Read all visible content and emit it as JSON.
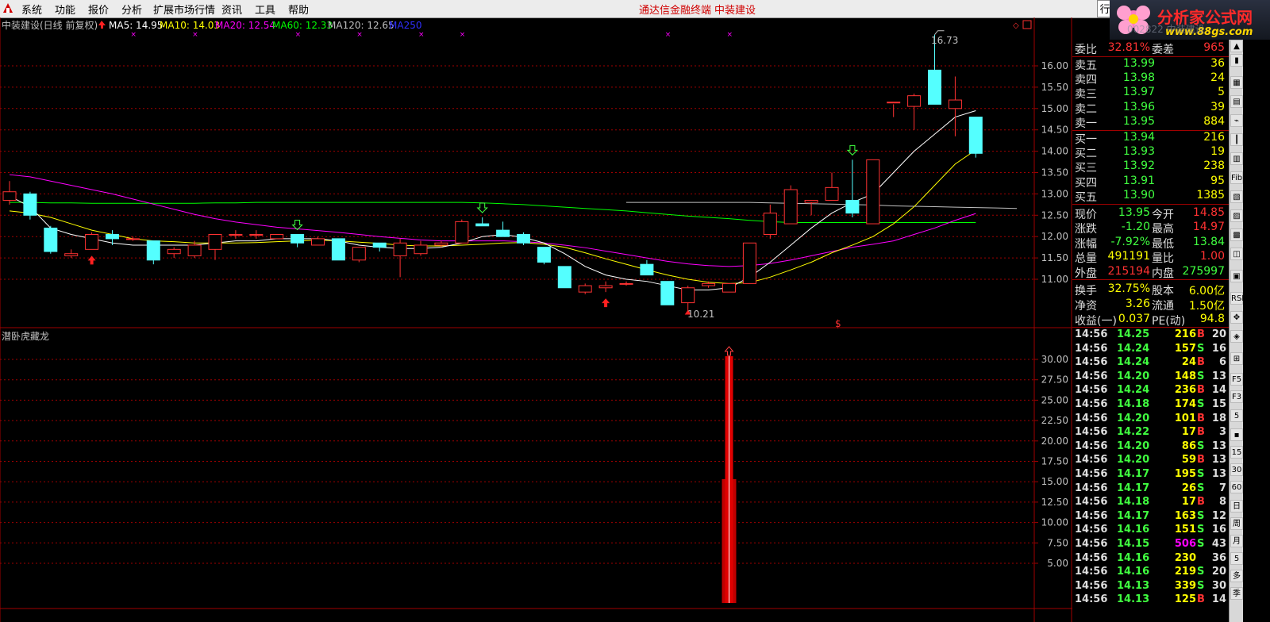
{
  "menubar": {
    "items": [
      "系统",
      "功能",
      "报价",
      "分析",
      "扩展市场行情",
      "资讯",
      "工具",
      "帮助"
    ],
    "center_title": "通达信金融终端",
    "center_stock": "中装建设",
    "side_tab": "行"
  },
  "brand": {
    "name": "分析家公式网",
    "url": "www.88gs.com",
    "behind_text": "002822 中装建设"
  },
  "chart_header": {
    "title": "中装建设(日线 前复权)",
    "ma5": "MA5: 14.95",
    "ma10": "MA10: 14.03",
    "ma20": "MA20: 12.54",
    "ma60": "MA60: 12.33",
    "ma120": "MA120: 12.65",
    "ma250": "MA250"
  },
  "indicator_title": "潜卧虎藏龙",
  "price_axis": [
    "16.00",
    "15.50",
    "15.00",
    "14.50",
    "14.00",
    "13.50",
    "13.00",
    "12.50",
    "12.00",
    "11.50",
    "11.00"
  ],
  "indicator_axis": [
    "30.00",
    "27.50",
    "25.00",
    "22.50",
    "20.00",
    "17.50",
    "15.00",
    "12.50",
    "10.00",
    "7.50",
    "5.00"
  ],
  "annotations": {
    "high": "16.73",
    "low": "10.21",
    "signal": "$"
  },
  "colors": {
    "up": "#ff3232",
    "down": "#54ffff",
    "ma5": "#ffffff",
    "ma10": "#ffff00",
    "ma20": "#ff00ff",
    "ma60": "#00ff00",
    "ma120": "#c0c0c0",
    "ma250": "#3030ff",
    "grid": "#a00000",
    "indicator_bar": "#c00000"
  },
  "chart_data": {
    "type": "candlestick",
    "price_ylim": [
      10.0,
      17.0
    ],
    "candles": [
      {
        "o": 12.85,
        "h": 13.3,
        "l": 12.75,
        "c": 13.05
      },
      {
        "o": 13.0,
        "h": 13.05,
        "l": 12.4,
        "c": 12.5
      },
      {
        "o": 12.2,
        "h": 12.25,
        "l": 11.6,
        "c": 11.65
      },
      {
        "o": 11.55,
        "h": 11.7,
        "l": 11.5,
        "c": 11.6
      },
      {
        "o": 11.7,
        "h": 12.1,
        "l": 11.7,
        "c": 12.05
      },
      {
        "o": 12.05,
        "h": 12.15,
        "l": 11.8,
        "c": 11.95
      },
      {
        "o": 11.95,
        "h": 12.0,
        "l": 11.9,
        "c": 11.95
      },
      {
        "o": 11.9,
        "h": 11.9,
        "l": 11.35,
        "c": 11.45
      },
      {
        "o": 11.6,
        "h": 11.75,
        "l": 11.5,
        "c": 11.7
      },
      {
        "o": 11.55,
        "h": 11.9,
        "l": 11.5,
        "c": 11.8
      },
      {
        "o": 11.7,
        "h": 12.05,
        "l": 11.45,
        "c": 12.05
      },
      {
        "o": 12.05,
        "h": 12.15,
        "l": 11.95,
        "c": 12.05
      },
      {
        "o": 12.05,
        "h": 12.15,
        "l": 11.95,
        "c": 12.05
      },
      {
        "o": 11.95,
        "h": 12.05,
        "l": 11.95,
        "c": 12.05
      },
      {
        "o": 12.05,
        "h": 12.05,
        "l": 11.75,
        "c": 11.85
      },
      {
        "o": 11.8,
        "h": 12.0,
        "l": 11.8,
        "c": 11.95
      },
      {
        "o": 11.95,
        "h": 11.95,
        "l": 11.45,
        "c": 11.45
      },
      {
        "o": 11.45,
        "h": 11.75,
        "l": 11.4,
        "c": 11.75
      },
      {
        "o": 11.85,
        "h": 11.85,
        "l": 11.65,
        "c": 11.75
      },
      {
        "o": 11.55,
        "h": 11.95,
        "l": 11.05,
        "c": 11.85
      },
      {
        "o": 11.6,
        "h": 11.9,
        "l": 11.55,
        "c": 11.8
      },
      {
        "o": 11.8,
        "h": 11.9,
        "l": 11.75,
        "c": 11.85
      },
      {
        "o": 11.85,
        "h": 12.4,
        "l": 11.85,
        "c": 12.35
      },
      {
        "o": 12.3,
        "h": 12.45,
        "l": 12.25,
        "c": 12.25
      },
      {
        "o": 12.15,
        "h": 12.35,
        "l": 12.0,
        "c": 12.0
      },
      {
        "o": 12.05,
        "h": 12.1,
        "l": 11.8,
        "c": 11.85
      },
      {
        "o": 11.75,
        "h": 11.75,
        "l": 11.35,
        "c": 11.4
      },
      {
        "o": 11.3,
        "h": 11.3,
        "l": 10.8,
        "c": 10.8
      },
      {
        "o": 10.7,
        "h": 10.9,
        "l": 10.65,
        "c": 10.85
      },
      {
        "o": 10.8,
        "h": 10.95,
        "l": 10.7,
        "c": 10.85
      },
      {
        "o": 10.9,
        "h": 10.95,
        "l": 10.85,
        "c": 10.9
      },
      {
        "o": 11.35,
        "h": 11.45,
        "l": 11.1,
        "c": 11.1
      },
      {
        "o": 10.95,
        "h": 10.95,
        "l": 10.4,
        "c": 10.4
      },
      {
        "o": 10.45,
        "h": 10.85,
        "l": 10.21,
        "c": 10.8
      },
      {
        "o": 10.85,
        "h": 10.95,
        "l": 10.8,
        "c": 10.9
      },
      {
        "o": 10.7,
        "h": 10.9,
        "l": 10.7,
        "c": 10.9
      },
      {
        "o": 10.9,
        "h": 11.85,
        "l": 10.9,
        "c": 11.85
      },
      {
        "o": 12.05,
        "h": 12.75,
        "l": 11.95,
        "c": 12.55
      },
      {
        "o": 12.3,
        "h": 13.2,
        "l": 12.3,
        "c": 13.1
      },
      {
        "o": 12.8,
        "h": 12.85,
        "l": 12.5,
        "c": 12.85
      },
      {
        "o": 12.85,
        "h": 13.5,
        "l": 12.85,
        "c": 13.15
      },
      {
        "o": 12.85,
        "h": 13.8,
        "l": 12.45,
        "c": 12.55
      },
      {
        "o": 12.3,
        "h": 13.8,
        "l": 12.3,
        "c": 13.8
      },
      {
        "o": 15.15,
        "h": 15.1,
        "l": 14.8,
        "c": 15.15
      },
      {
        "o": 15.05,
        "h": 15.35,
        "l": 14.5,
        "c": 15.3
      },
      {
        "o": 15.9,
        "h": 16.73,
        "l": 15.1,
        "c": 15.1
      },
      {
        "o": 15.0,
        "h": 15.75,
        "l": 14.35,
        "c": 15.2
      },
      {
        "o": 14.8,
        "h": 14.8,
        "l": 13.85,
        "c": 13.95
      }
    ],
    "ma5": [
      12.95,
      12.7,
      12.2,
      12.05,
      11.95,
      11.85,
      11.8,
      11.8,
      11.8,
      11.8,
      11.85,
      11.9,
      11.9,
      11.95,
      11.95,
      11.95,
      11.9,
      11.8,
      11.75,
      11.72,
      11.72,
      11.75,
      11.85,
      12.0,
      12.05,
      11.98,
      11.85,
      11.6,
      11.3,
      11.1,
      11.0,
      10.95,
      10.85,
      10.75,
      10.75,
      10.8,
      11.05,
      11.4,
      11.8,
      12.2,
      12.55,
      12.8,
      13.0,
      13.5,
      14.0,
      14.4,
      14.8,
      14.95
    ],
    "ma10": [
      12.6,
      12.55,
      12.45,
      12.3,
      12.15,
      12.05,
      11.95,
      11.9,
      11.88,
      11.85,
      11.85,
      11.85,
      11.86,
      11.88,
      11.9,
      11.92,
      11.9,
      11.87,
      11.84,
      11.8,
      11.78,
      11.78,
      11.8,
      11.82,
      11.85,
      11.86,
      11.82,
      11.75,
      11.62,
      11.48,
      11.35,
      11.22,
      11.1,
      11.0,
      10.93,
      10.9,
      10.92,
      11.05,
      11.22,
      11.4,
      11.62,
      11.8,
      12.0,
      12.3,
      12.7,
      13.2,
      13.7,
      14.03
    ],
    "ma20": [
      13.45,
      13.4,
      13.3,
      13.2,
      13.1,
      13.0,
      12.88,
      12.76,
      12.64,
      12.52,
      12.42,
      12.34,
      12.28,
      12.22,
      12.18,
      12.14,
      12.1,
      12.05,
      12.0,
      11.96,
      11.92,
      11.9,
      11.9,
      11.9,
      11.9,
      11.88,
      11.85,
      11.8,
      11.74,
      11.66,
      11.58,
      11.5,
      11.42,
      11.36,
      11.32,
      11.3,
      11.32,
      11.37,
      11.45,
      11.55,
      11.65,
      11.75,
      11.82,
      11.9,
      12.05,
      12.2,
      12.38,
      12.54
    ],
    "ma60": [
      12.8,
      12.8,
      12.79,
      12.79,
      12.78,
      12.78,
      12.78,
      12.78,
      12.78,
      12.78,
      12.79,
      12.79,
      12.8,
      12.8,
      12.8,
      12.8,
      12.8,
      12.8,
      12.8,
      12.8,
      12.8,
      12.8,
      12.8,
      12.79,
      12.77,
      12.75,
      12.72,
      12.69,
      12.66,
      12.63,
      12.6,
      12.56,
      12.52,
      12.48,
      12.45,
      12.42,
      12.38,
      12.35,
      12.33,
      12.33,
      12.33,
      12.33,
      12.33,
      12.33,
      12.33,
      12.33,
      12.33,
      12.33
    ],
    "ma120": {
      "start_index": 29,
      "values": [
        12.8,
        12.8,
        12.8,
        12.8,
        12.8,
        12.8,
        12.8,
        12.79,
        12.78,
        12.77,
        12.76,
        12.75,
        12.74,
        12.72,
        12.71,
        12.7,
        12.69,
        12.68,
        12.67,
        12.66
      ]
    },
    "buy_arrows_index": [
      4,
      29
    ],
    "sell_arrows_index": [
      14,
      23,
      41
    ],
    "top_markers_index": [
      6,
      9,
      14,
      17,
      20,
      22,
      32,
      35
    ],
    "indicator_values": [
      {
        "index": 35,
        "value": 30.4
      }
    ]
  },
  "quote": {
    "weibi": {
      "label": "委比",
      "value": "32.81%",
      "label2": "委差",
      "value2": "965"
    },
    "sells": [
      {
        "label": "卖五",
        "price": "13.99",
        "vol": "36"
      },
      {
        "label": "卖四",
        "price": "13.98",
        "vol": "24"
      },
      {
        "label": "卖三",
        "price": "13.97",
        "vol": "5"
      },
      {
        "label": "卖二",
        "price": "13.96",
        "vol": "39"
      },
      {
        "label": "卖一",
        "price": "13.95",
        "vol": "884"
      }
    ],
    "buys": [
      {
        "label": "买一",
        "price": "13.94",
        "vol": "216"
      },
      {
        "label": "买二",
        "price": "13.93",
        "vol": "19"
      },
      {
        "label": "买三",
        "price": "13.92",
        "vol": "238"
      },
      {
        "label": "买四",
        "price": "13.91",
        "vol": "95"
      },
      {
        "label": "买五",
        "price": "13.90",
        "vol": "1385"
      }
    ],
    "stats1": [
      {
        "l1": "现价",
        "v1": "13.95",
        "l2": "今开",
        "v2": "14.85"
      },
      {
        "l1": "涨跌",
        "v1": "-1.20",
        "l2": "最高",
        "v2": "14.97"
      },
      {
        "l1": "涨幅",
        "v1": "-7.92%",
        "l2": "最低",
        "v2": "13.84"
      },
      {
        "l1": "总量",
        "v1": "491191",
        "l2": "量比",
        "v2": "1.00"
      },
      {
        "l1": "外盘",
        "v1": "215194",
        "l2": "内盘",
        "v2": "275997"
      }
    ],
    "stats2": [
      {
        "l1": "换手",
        "v1": "32.75%",
        "l2": "股本",
        "v2": "6.00亿"
      },
      {
        "l1": "净资",
        "v1": "3.26",
        "l2": "流通",
        "v2": "1.50亿"
      },
      {
        "l1": "收益(一)",
        "v1": "0.037",
        "l2": "PE(动)",
        "v2": "94.8"
      }
    ]
  },
  "ticks": [
    {
      "t": "14:56",
      "p": "14.25",
      "v": "216",
      "s": "B",
      "n": "20"
    },
    {
      "t": "14:56",
      "p": "14.24",
      "v": "157",
      "s": "S",
      "n": "16"
    },
    {
      "t": "14:56",
      "p": "14.24",
      "v": "24",
      "s": "B",
      "n": "6"
    },
    {
      "t": "14:56",
      "p": "14.20",
      "v": "148",
      "s": "S",
      "n": "13"
    },
    {
      "t": "14:56",
      "p": "14.24",
      "v": "236",
      "s": "B",
      "n": "14"
    },
    {
      "t": "14:56",
      "p": "14.18",
      "v": "174",
      "s": "S",
      "n": "15"
    },
    {
      "t": "14:56",
      "p": "14.20",
      "v": "101",
      "s": "B",
      "n": "18"
    },
    {
      "t": "14:56",
      "p": "14.22",
      "v": "17",
      "s": "B",
      "n": "3"
    },
    {
      "t": "14:56",
      "p": "14.20",
      "v": "86",
      "s": "S",
      "n": "13"
    },
    {
      "t": "14:56",
      "p": "14.20",
      "v": "59",
      "s": "B",
      "n": "13"
    },
    {
      "t": "14:56",
      "p": "14.17",
      "v": "195",
      "s": "S",
      "n": "13"
    },
    {
      "t": "14:56",
      "p": "14.17",
      "v": "26",
      "s": "S",
      "n": "7"
    },
    {
      "t": "14:56",
      "p": "14.18",
      "v": "17",
      "s": "B",
      "n": "8"
    },
    {
      "t": "14:56",
      "p": "14.17",
      "v": "163",
      "s": "S",
      "n": "12"
    },
    {
      "t": "14:56",
      "p": "14.16",
      "v": "151",
      "s": "S",
      "n": "16"
    },
    {
      "t": "14:56",
      "p": "14.15",
      "v": "506",
      "s": "S",
      "n": "43"
    },
    {
      "t": "14:56",
      "p": "14.16",
      "v": "230",
      "s": "",
      "n": "36"
    },
    {
      "t": "14:56",
      "p": "14.16",
      "v": "219",
      "s": "S",
      "n": "20"
    },
    {
      "t": "14:56",
      "p": "14.13",
      "v": "339",
      "s": "S",
      "n": "30"
    },
    {
      "t": "14:56",
      "p": "14.13",
      "v": "125",
      "s": "B",
      "n": "14"
    }
  ],
  "toolbar_labels": [
    "RSI",
    "F5",
    "F3",
    "5",
    "15",
    "30",
    "60",
    "日",
    "周",
    "月",
    "多",
    "季"
  ]
}
